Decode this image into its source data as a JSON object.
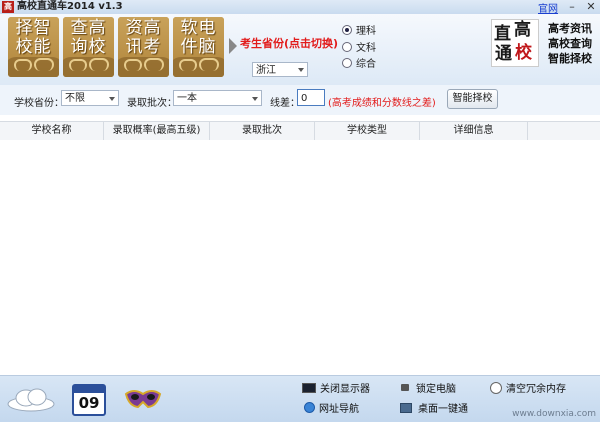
{
  "window": {
    "title": "高校直通车2014 v1.3",
    "homepage_link": "官网",
    "minimize_glyph": "–",
    "close_glyph": "✕"
  },
  "header": {
    "tiles": [
      {
        "line1": "择智",
        "line2": "校能"
      },
      {
        "line1": "查高",
        "line2": "询校"
      },
      {
        "line1": "资高",
        "line2": "讯考"
      },
      {
        "line1": "软电",
        "line2": "件脑"
      }
    ],
    "province_prompt": "考生省份(点击切换)",
    "province_value": "浙江",
    "subjects": [
      {
        "label": "理科",
        "selected": true
      },
      {
        "label": "文科",
        "selected": false
      },
      {
        "label": "综合",
        "selected": false
      }
    ],
    "logo_chars": [
      "直",
      "高",
      "通",
      "校"
    ],
    "side_links": [
      "高考资讯",
      "高校查询",
      "智能择校"
    ]
  },
  "filters": {
    "province_label": "学校省份：",
    "province_value": "不限",
    "batch_label": "录取批次：",
    "batch_value": "一本",
    "score_label": "线差：",
    "score_value": "0",
    "hint": "(高考成绩和分数线之差)",
    "smart_button": "智能择校"
  },
  "table": {
    "columns": [
      "学校名称",
      "录取概率(最高五级)",
      "录取批次",
      "学校类型",
      "详细信息"
    ]
  },
  "footer": {
    "calendar_day": "09",
    "close_display": "关闭显示器",
    "lock_pc": "锁定电脑",
    "clean_memory": "清空冗余内存",
    "web_nav": "网址导航",
    "desktop_clean": "桌面一键通",
    "watermark": "www.downxia.com"
  }
}
